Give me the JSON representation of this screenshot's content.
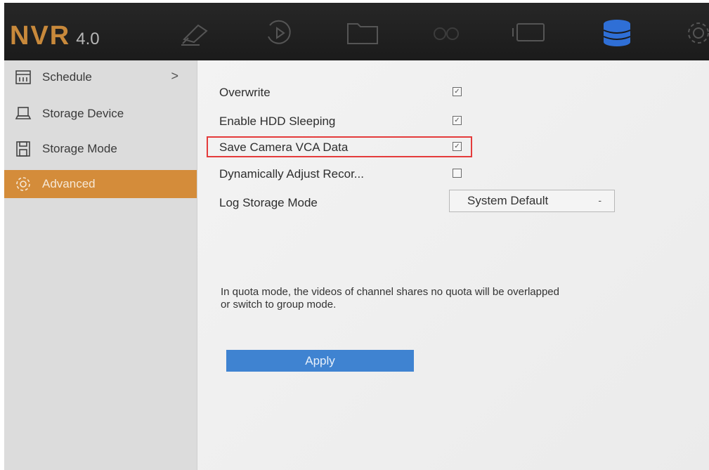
{
  "header": {
    "logo": "NVR",
    "version": "4.0",
    "toolbar_icons": [
      "camera-icon",
      "playback-icon",
      "folder-icon",
      "intelligence-icon",
      "display-icon",
      "storage-icon",
      "settings-icon"
    ],
    "active_icon_color": "#2f6fd6"
  },
  "sidebar": {
    "items": [
      {
        "label": "Schedule",
        "icon": "calendar-icon",
        "arrow": ">"
      },
      {
        "label": "Storage Device",
        "icon": "hdd-icon"
      },
      {
        "label": "Storage Mode",
        "icon": "disk-icon"
      },
      {
        "label": "Advanced",
        "icon": "gear-icon",
        "active": true
      }
    ],
    "active_color": "#d48c3a"
  },
  "settings": {
    "overwrite": {
      "label": "Overwrite",
      "checked": true
    },
    "hdd_sleeping": {
      "label": "Enable HDD Sleeping",
      "checked": true
    },
    "save_vca": {
      "label": "Save Camera VCA Data",
      "checked": true,
      "highlighted": true
    },
    "dynamic_adjust": {
      "label": "Dynamically Adjust Recor...",
      "checked": false
    },
    "log_storage": {
      "label": "Log Storage Mode",
      "value": "System Default",
      "arrow": "-"
    }
  },
  "note": "In quota mode, the videos of channel shares no quota will be overlapped\nor switch to group mode.",
  "apply_label": "Apply",
  "highlight_color": "#e43b3b",
  "button_color": "#3f83d1"
}
